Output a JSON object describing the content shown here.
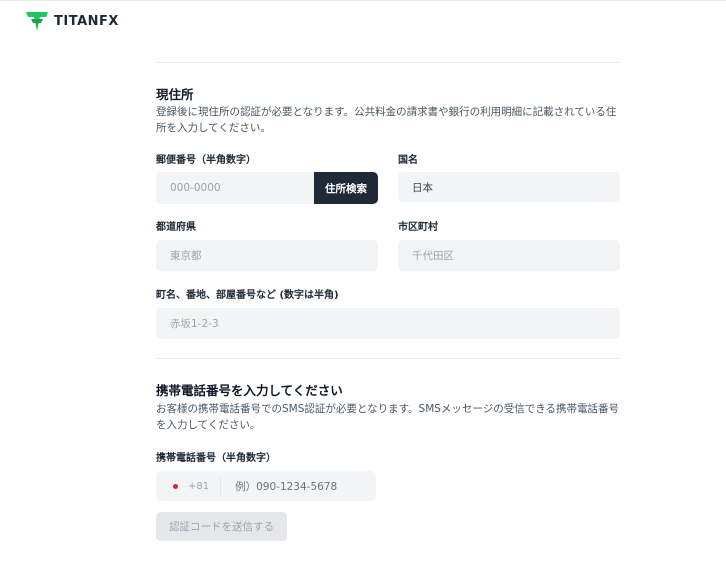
{
  "brand": {
    "logo_main": "TITAN",
    "logo_suffix": "FX"
  },
  "address": {
    "title": "現住所",
    "description": "登録後に現住所の認証が必要となります。公共料金の請求書や銀行の利用明細に記載されている住所を入力してください。",
    "postal_label": "郵便番号（半角数字）",
    "postal_placeholder": "000-0000",
    "search_button": "住所検索",
    "country_label": "国名",
    "country_value": "日本",
    "prefecture_label": "都道府県",
    "prefecture_placeholder": "東京都",
    "city_label": "市区町村",
    "city_placeholder": "千代田区",
    "street_label": "町名、番地、部屋番号など (数字は半角)",
    "street_placeholder": "赤坂1-2-3"
  },
  "phone": {
    "title": "携帯電話番号を入力してください",
    "description": "お客様の携帯電話番号でのSMS認証が必要となります。SMSメッセージの受信できる携帯電話番号を入力してください。",
    "label": "携帯電話番号（半角数字）",
    "country_code": "+81",
    "placeholder": "例）090-1234-5678",
    "send_button": "認証コードを送信する"
  },
  "colors": {
    "brand_green": "#22c55e",
    "dark_button": "#1f2937",
    "field_bg": "#f3f4f6"
  }
}
